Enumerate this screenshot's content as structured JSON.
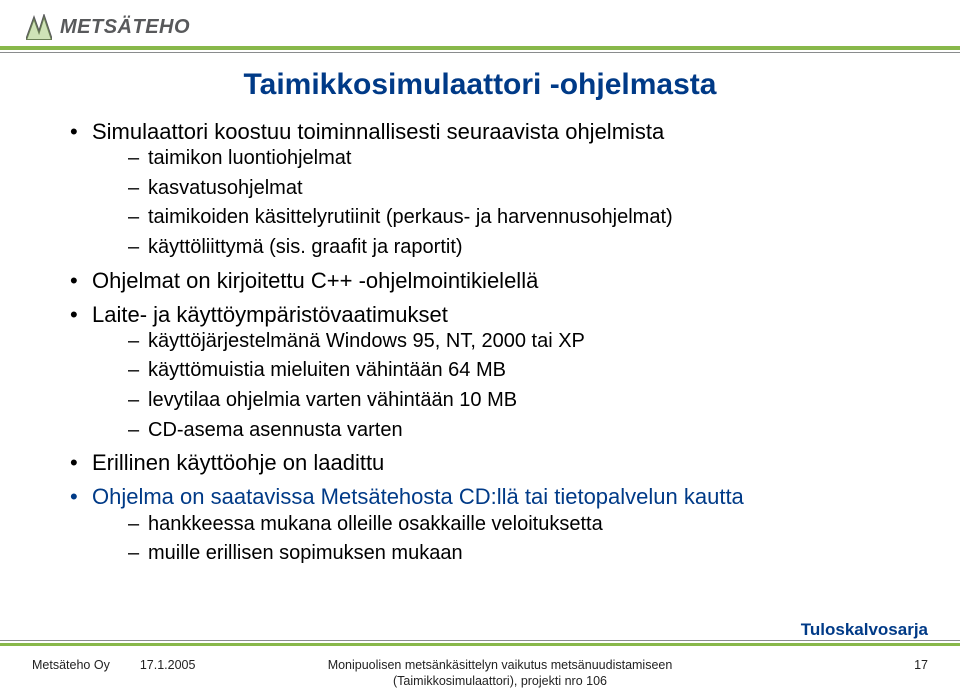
{
  "logo": {
    "text": "METSÄTEHO"
  },
  "title": "Taimikkosimulaattori -ohjelmasta",
  "bullets": [
    {
      "text": "Simulaattori koostuu toiminnallisesti seuraavista ohjelmista",
      "sub": [
        "taimikon luontiohjelmat",
        "kasvatusohjelmat",
        "taimikoiden käsittelyrutiinit (perkaus- ja harvennusohjelmat)",
        "käyttöliittymä (sis. graafit ja raportit)"
      ]
    },
    {
      "text": "Ohjelmat on kirjoitettu C++ -ohjelmointikielellä",
      "sub": []
    },
    {
      "text": "Laite- ja käyttöympäristövaatimukset",
      "sub": [
        "käyttöjärjestelmänä Windows 95, NT, 2000 tai XP",
        "käyttömuistia mieluiten vähintään 64 MB",
        "levytilaa ohjelmia varten vähintään 10 MB",
        "CD-asema asennusta varten"
      ]
    },
    {
      "text": "Erillinen käyttöohje on laadittu",
      "sub": []
    },
    {
      "text": "Ohjelma on saatavissa Metsätehosta CD:llä tai tietopalvelun kautta",
      "blue": true,
      "sub": [
        "hankkeessa mukana olleille osakkaille veloituksetta",
        "muille erillisen sopimuksen mukaan"
      ]
    }
  ],
  "series": "Tuloskalvosarja",
  "footer": {
    "left1": "Metsäteho Oy",
    "left2": "17.1.2005",
    "center1": "Monipuolisen metsänkäsittelyn vaikutus metsänuudistamiseen",
    "center2": "(Taimikkosimulaattori), projekti nro 106",
    "page": "17"
  }
}
